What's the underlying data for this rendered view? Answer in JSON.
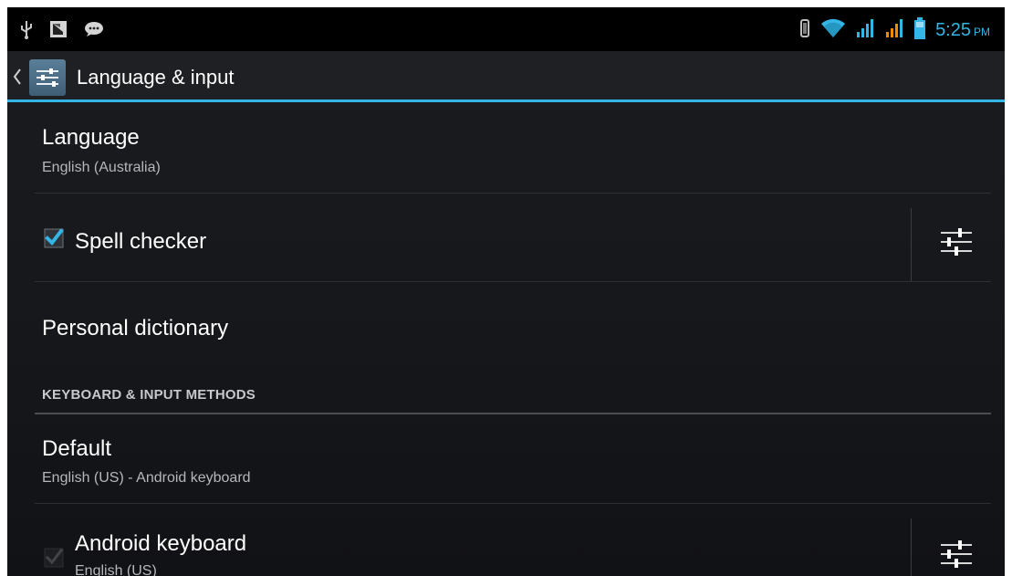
{
  "status_bar": {
    "time": "5:25",
    "ampm": "PM",
    "left_icons": [
      "usb-icon",
      "screenshot-notification-icon",
      "message-icon"
    ],
    "right_icons": [
      "vibrate-icon",
      "wifi-icon",
      "signal-icon-1",
      "signal-icon-2",
      "battery-icon"
    ],
    "accent_color": "#33b5e5"
  },
  "action_bar": {
    "title": "Language & input",
    "icon": "settings-sliders-icon"
  },
  "list": {
    "language": {
      "title": "Language",
      "summary": "English (Australia)"
    },
    "spell_checker": {
      "title": "Spell checker",
      "checked": true,
      "settings_icon": "settings-sliders-icon"
    },
    "personal_dictionary": {
      "title": "Personal dictionary"
    },
    "keyboard_section": {
      "header": "KEYBOARD & INPUT METHODS"
    },
    "default": {
      "title": "Default",
      "summary": "English (US) - Android keyboard"
    },
    "android_keyboard": {
      "title": "Android keyboard",
      "summary": "English (US)",
      "checked": true,
      "enabled": false,
      "settings_icon": "settings-sliders-icon"
    }
  }
}
